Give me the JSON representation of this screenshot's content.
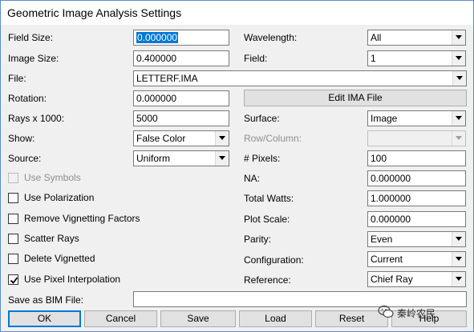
{
  "window": {
    "title": "Geometric Image Analysis Settings"
  },
  "fields": {
    "field_size": {
      "label": "Field Size:",
      "value": "0.000000"
    },
    "image_size": {
      "label": "Image Size:",
      "value": "0.400000"
    },
    "file": {
      "label": "File:",
      "value": "LETTERF.IMA"
    },
    "rotation": {
      "label": "Rotation:",
      "value": "0.000000"
    },
    "rays": {
      "label": "Rays x 1000:",
      "value": "5000"
    },
    "show": {
      "label": "Show:",
      "value": "False Color"
    },
    "source": {
      "label": "Source:",
      "value": "Uniform"
    },
    "wavelength": {
      "label": "Wavelength:",
      "value": "All"
    },
    "field": {
      "label": "Field:",
      "value": "1"
    },
    "edit_ima_label": "Edit IMA File",
    "surface": {
      "label": "Surface:",
      "value": "Image"
    },
    "row_column": {
      "label": "Row/Column:",
      "value": ""
    },
    "pixels": {
      "label": "# Pixels:",
      "value": "100"
    },
    "na": {
      "label": "NA:",
      "value": "0.000000"
    },
    "total_watts": {
      "label": "Total Watts:",
      "value": "1.000000"
    },
    "plot_scale": {
      "label": "Plot Scale:",
      "value": "0.000000"
    },
    "parity": {
      "label": "Parity:",
      "value": "Even"
    },
    "configuration": {
      "label": "Configuration:",
      "value": "Current"
    },
    "reference": {
      "label": "Reference:",
      "value": "Chief Ray"
    },
    "save_bim": {
      "label": "Save as BIM File:",
      "value": ""
    }
  },
  "checkboxes": {
    "use_symbols": {
      "label": "Use Symbols",
      "checked": false,
      "enabled": false
    },
    "use_polarization": {
      "label": "Use Polarization",
      "checked": false,
      "enabled": true
    },
    "remove_vignetting": {
      "label": "Remove Vignetting Factors",
      "checked": false,
      "enabled": true
    },
    "scatter_rays": {
      "label": "Scatter Rays",
      "checked": false,
      "enabled": true
    },
    "delete_vignetted": {
      "label": "Delete Vignetted",
      "checked": false,
      "enabled": true
    },
    "use_pixel_interp": {
      "label": "Use Pixel Interpolation",
      "checked": true,
      "enabled": true
    }
  },
  "buttons": {
    "ok": "OK",
    "cancel": "Cancel",
    "save": "Save",
    "load": "Load",
    "reset": "Reset",
    "help": "Help"
  },
  "watermark": {
    "text": "秦岭农民"
  },
  "colors": {
    "accent": "#0078d7",
    "window_bg": "#f0f0f0",
    "border": "#7a7a7a"
  }
}
